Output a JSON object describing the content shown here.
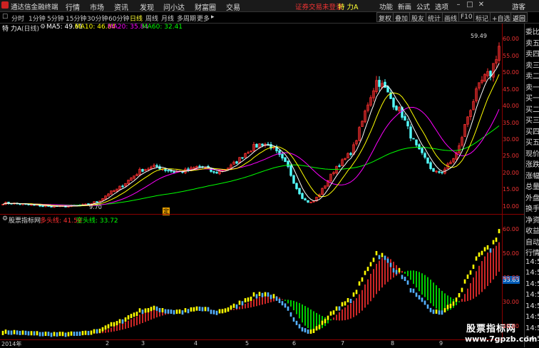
{
  "titlebar": {
    "app_name": "通达信金融终端",
    "menu": [
      "行情",
      "市场",
      "资讯",
      "发现",
      "问小达",
      "财富圈",
      "交易"
    ],
    "notice": "证券交易未登录",
    "stock": "特 力A",
    "actions": [
      "功能",
      "新画",
      "公式",
      "选项"
    ],
    "guest": "游客"
  },
  "toolbar": {
    "periods": [
      "分时",
      "1分钟",
      "5分钟",
      "15分钟",
      "30分钟",
      "60分钟",
      "日线",
      "周线",
      "月线",
      "多周期",
      "更多"
    ],
    "selected_period": "日线",
    "right_buttons": [
      "复权",
      "叠加",
      "股友",
      "统计",
      "画线",
      "F10",
      "标记",
      "+自选",
      "返回"
    ]
  },
  "info": {
    "stock_title": "特 力A",
    "period_tag": "(日线)",
    "ma5_label": "MA5: 49.61",
    "ma10_label": "MA10: 46.84",
    "ma20_label": "MA20: 35.84",
    "ma60_label": "MA60: 32.41"
  },
  "kchart": {
    "y_ticks": [
      "60.00",
      "55.00",
      "50.00",
      "45.00",
      "40.00",
      "35.00",
      "30.00",
      "25.00",
      "20.00",
      "15.00",
      "10.00"
    ],
    "y_values": [
      60,
      55,
      50,
      45,
      40,
      35,
      30,
      25,
      20,
      15,
      10
    ],
    "high_label": "59.49",
    "low_label": "9.70",
    "event_label": "定"
  },
  "indicator": {
    "name": "股票指标网",
    "long_label": "多头线: 41.58",
    "short_label": "空头线: 33.72",
    "y_ticks": [
      "60.00",
      "50.00",
      "40.00",
      "30.00",
      "20.00"
    ],
    "y_values": [
      60,
      50,
      40,
      30,
      20
    ],
    "price_box": "33.63"
  },
  "xaxis": {
    "labels": [
      "2014年",
      "2",
      "3",
      "4",
      "5",
      "6",
      "7",
      "8",
      "9"
    ]
  },
  "right_panel": [
    "委比",
    "卖五",
    "卖四",
    "卖三",
    "卖二",
    "卖一",
    "买一",
    "买二",
    "买三",
    "买四",
    "买五",
    "现价",
    "涨跌",
    "涨幅",
    "总量",
    "外盘",
    "换手",
    "净资",
    "收益",
    "自动",
    "行情",
    "14:5",
    "14:5",
    "14:5",
    "14:5",
    "14:5",
    "14:5",
    "14:5",
    "14:5"
  ],
  "watermark": {
    "line1": "股票指标网",
    "line2": "www.7gpzb.com"
  },
  "colors": {
    "up": "#ff3030",
    "down": "#54ffff",
    "ma5": "#ffffff",
    "ma10": "#ffff00",
    "ma20": "#ff00ff",
    "ma60": "#00ff00",
    "long_line": "#ff3030",
    "short_line": "#00ff00",
    "axis": "#8b0000"
  },
  "chart_data": {
    "type": "candlestick",
    "ylim": [
      8,
      62
    ],
    "close_trend": [
      11,
      11,
      10.8,
      10.5,
      10.4,
      10.2,
      10.1,
      10,
      10.1,
      10.2,
      10.4,
      11,
      12,
      14,
      15,
      17,
      19,
      21,
      21.5,
      22,
      21,
      20.5,
      20.5,
      21,
      22,
      21.5,
      20,
      21,
      22,
      24,
      26.5,
      28,
      29,
      28,
      25,
      22,
      16,
      12,
      11,
      14,
      18,
      22,
      24,
      27,
      34,
      42,
      48,
      45,
      41,
      38,
      32,
      27,
      24,
      20,
      20.5,
      23,
      27,
      36,
      43,
      48,
      50,
      58
    ]
  }
}
